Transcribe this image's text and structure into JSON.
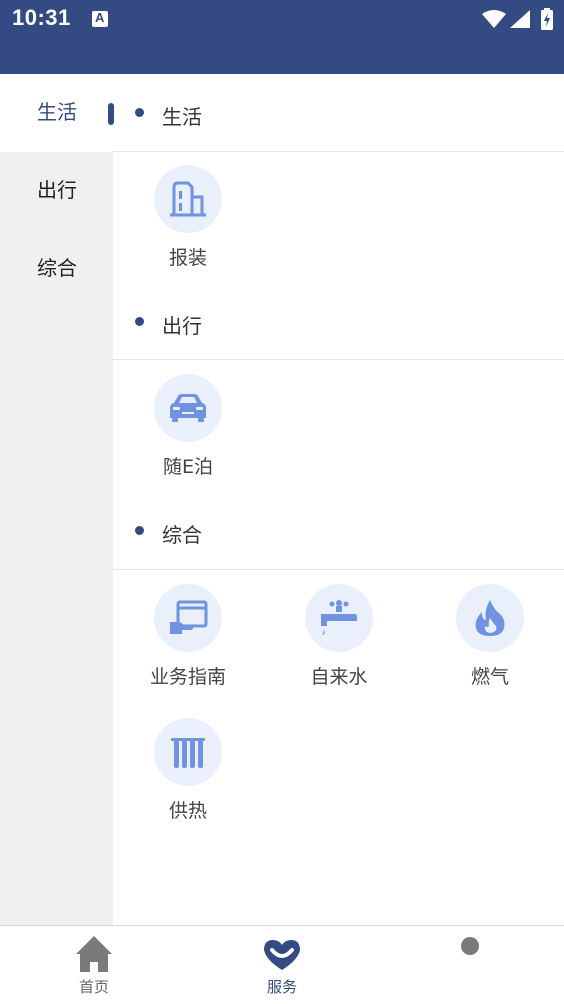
{
  "status_bar": {
    "time": "10:31",
    "app_icon_letter": "A"
  },
  "sidebar": {
    "items": [
      {
        "label": "生活",
        "active": true
      },
      {
        "label": "出行",
        "active": false
      },
      {
        "label": "综合",
        "active": false
      }
    ]
  },
  "sections": [
    {
      "title": "生活",
      "items": [
        {
          "label": "报装",
          "icon": "building-icon"
        }
      ]
    },
    {
      "title": "出行",
      "items": [
        {
          "label": "随E泊",
          "icon": "car-icon"
        }
      ]
    },
    {
      "title": "综合",
      "items": [
        {
          "label": "业务指南",
          "icon": "guide-hand-icon"
        },
        {
          "label": "自来水",
          "icon": "water-tap-icon"
        },
        {
          "label": "燃气",
          "icon": "flame-icon"
        },
        {
          "label": "供热",
          "icon": "radiator-icon"
        }
      ]
    }
  ],
  "bottom_nav": {
    "tabs": [
      {
        "label": "首页",
        "icon": "home-icon"
      },
      {
        "label": "服务",
        "icon": "heart-smile-icon",
        "active": true
      },
      {
        "label": "",
        "icon": "profile-icon"
      }
    ]
  },
  "colors": {
    "primary": "#334b82",
    "icon_fill": "#6f93e0",
    "icon_bg": "#eaf0fb",
    "sidebar_bg": "#f0f0f0"
  }
}
